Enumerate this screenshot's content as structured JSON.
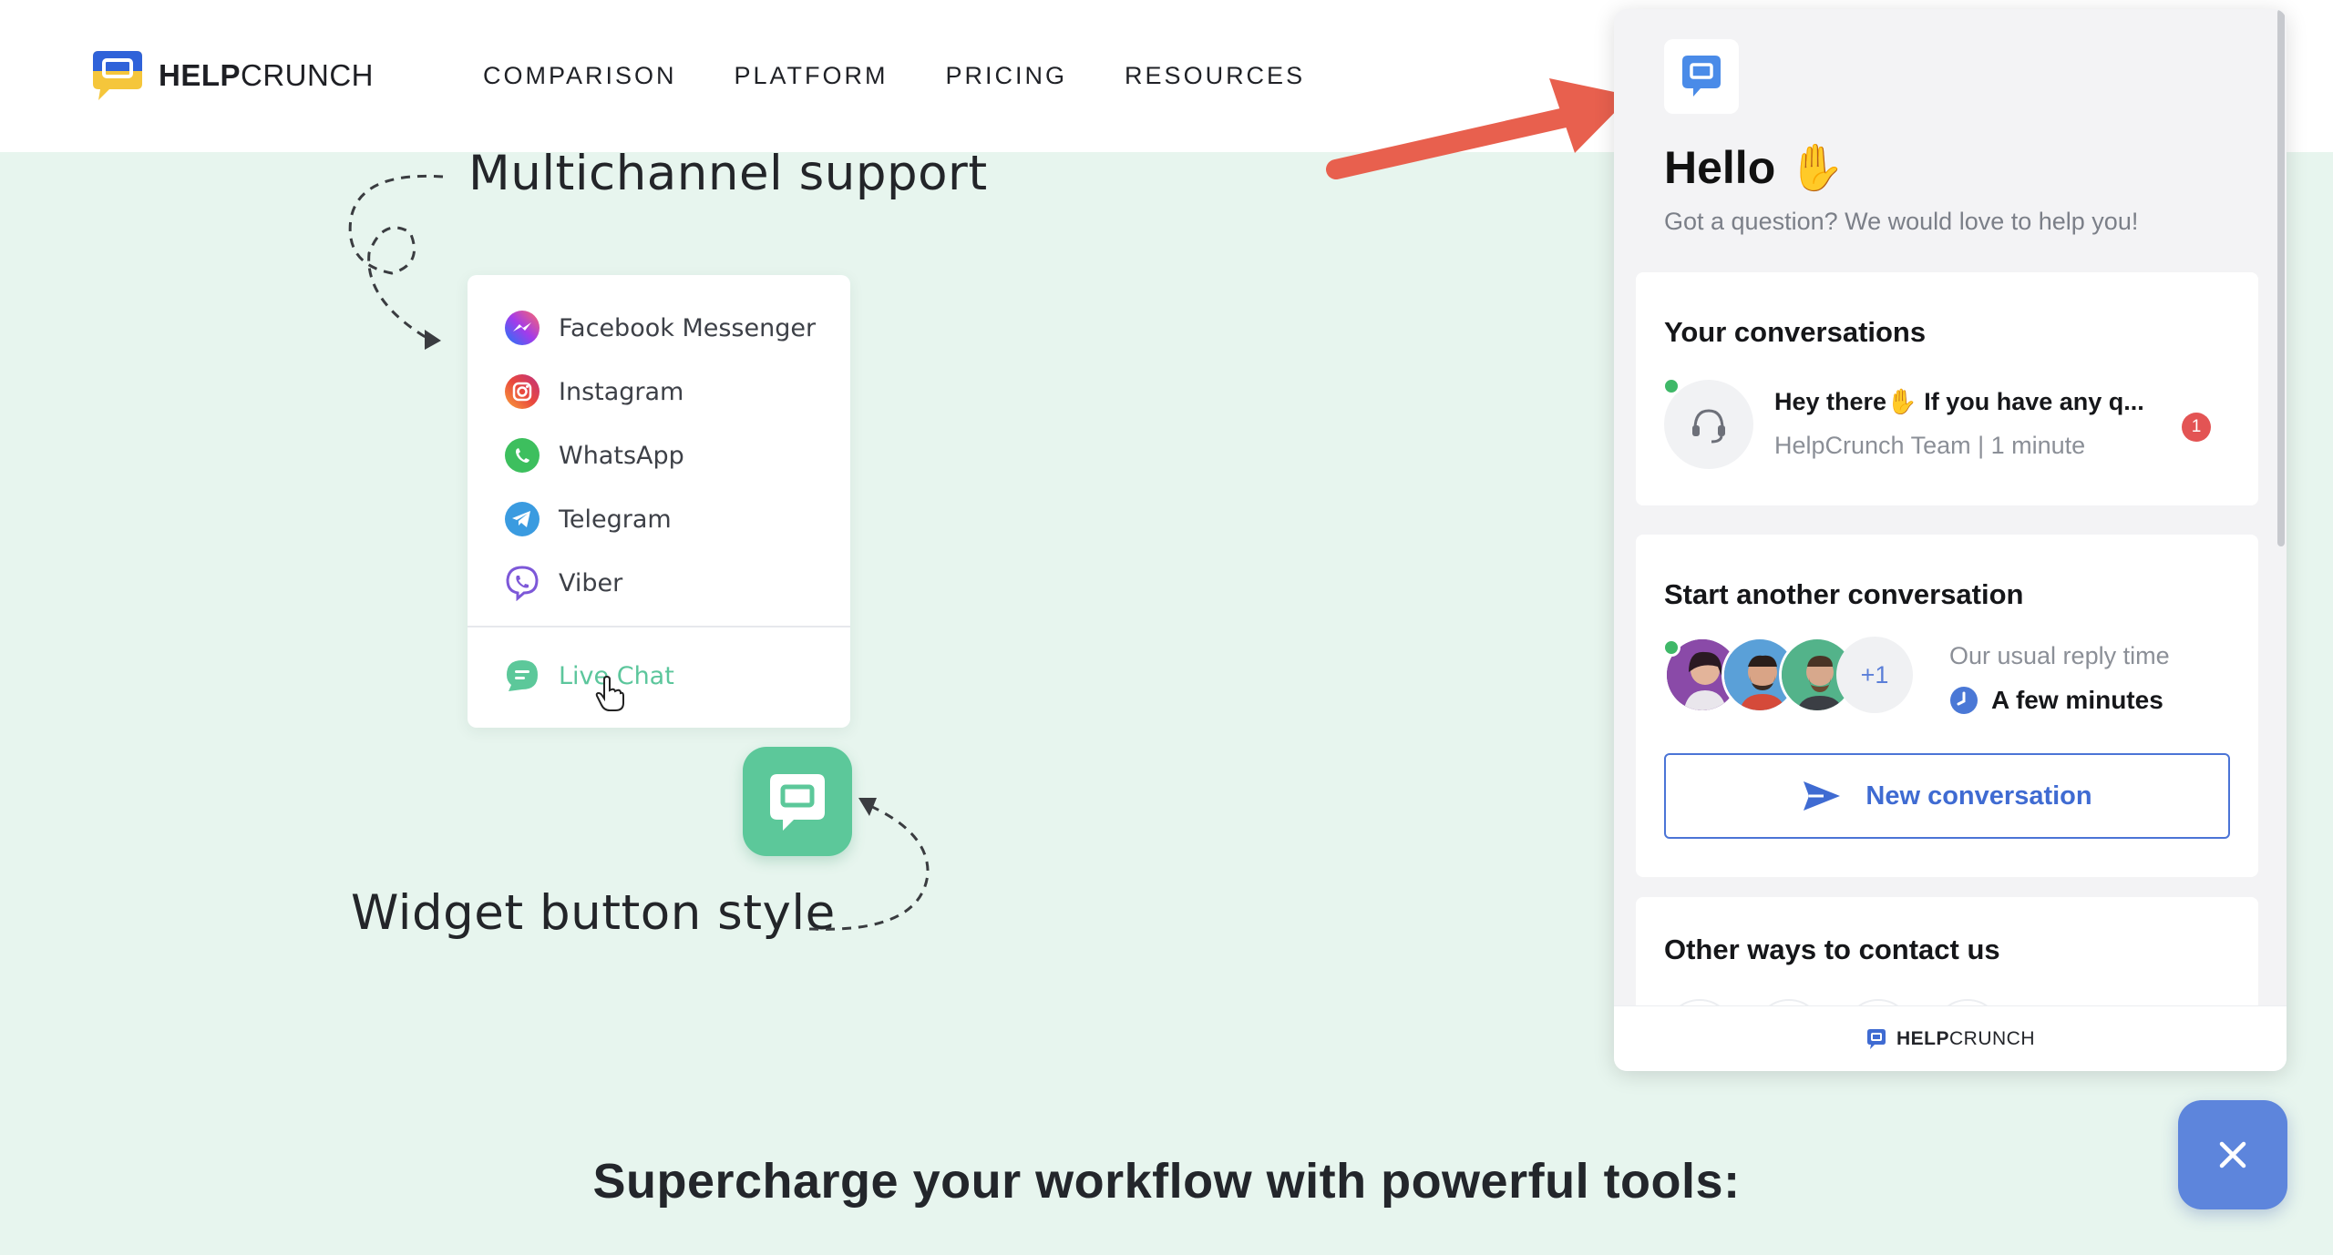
{
  "header": {
    "logo_bold": "HELP",
    "logo_light": "CRUNCH",
    "nav": [
      "COMPARISON",
      "PLATFORM",
      "PRICING",
      "RESOURCES"
    ]
  },
  "illustration": {
    "multichannel_title": "Multichannel support",
    "channels": [
      "Facebook Messenger",
      "Instagram",
      "WhatsApp",
      "Telegram",
      "Viber"
    ],
    "live_chat": "Live Chat",
    "widget_title": "Widget button style"
  },
  "headline": "Supercharge your workflow with powerful tools:",
  "chat_panel": {
    "hello": "Hello",
    "hello_emoji": "✋",
    "subtitle": "Got a question? We would love to help you!",
    "your_conversations": {
      "title": "Your conversations",
      "message_prefix": "Hey there",
      "message_emoji": "✋",
      "message_suffix": "If you have any q...",
      "meta": "HelpCrunch Team | 1 minute",
      "unread": "1"
    },
    "start_conversation": {
      "title": "Start another conversation",
      "more_agents": "+1",
      "reply_label": "Our usual reply time",
      "reply_value": "A few minutes",
      "button": "New conversation"
    },
    "other_ways": {
      "title": "Other ways to contact us"
    },
    "footer_bold": "HELP",
    "footer_light": "CRUNCH"
  },
  "colors": {
    "accent_blue": "#4b74d6",
    "brand_green": "#5cc89a",
    "page_bg": "#e7f5ee",
    "arrow_red": "#e8604e",
    "badge_red": "#e35454"
  },
  "icons": {
    "close_fab": "close-icon",
    "send": "send-icon",
    "clock": "clock-icon"
  }
}
